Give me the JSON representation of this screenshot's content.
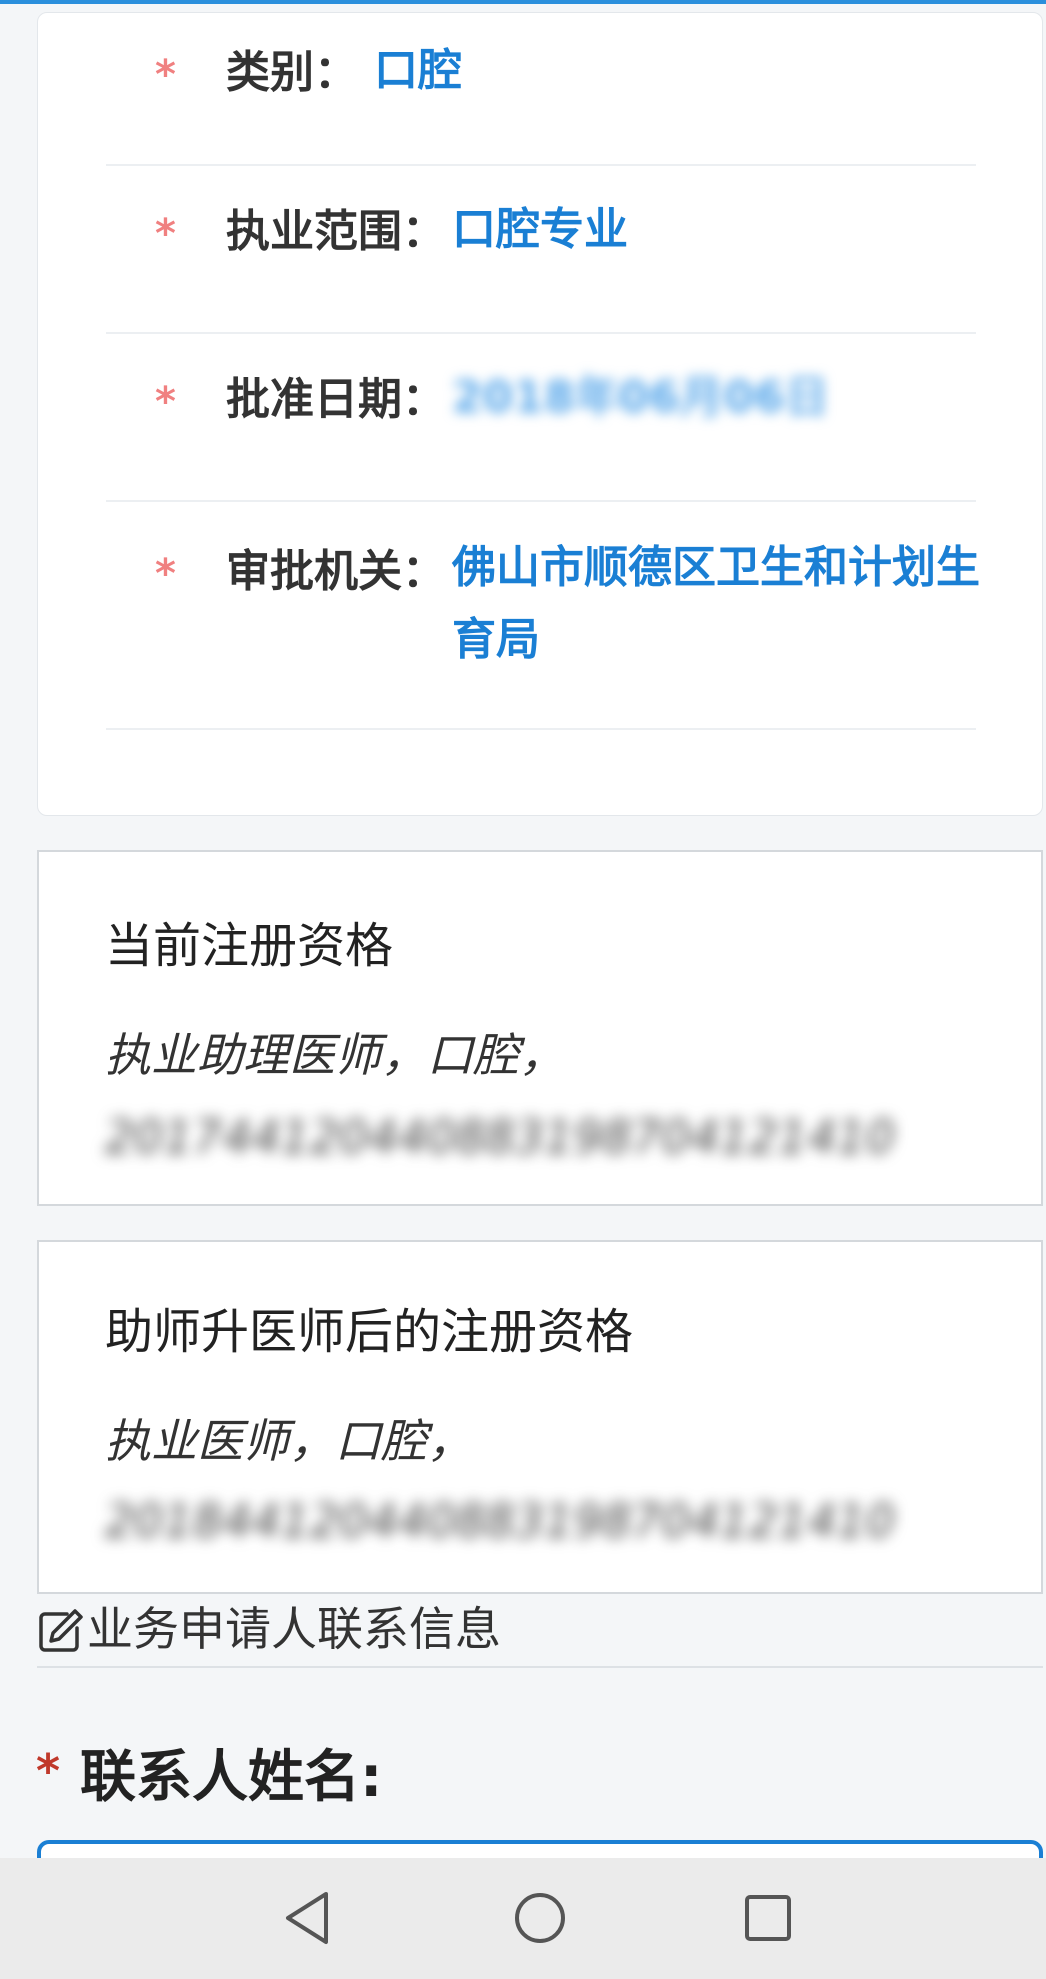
{
  "info_card": {
    "rows": [
      {
        "label": "类别：",
        "value": "口腔"
      },
      {
        "label": "执业范围：",
        "value": "口腔专业"
      },
      {
        "label": "批准日期：",
        "value": "2018年06月06日"
      },
      {
        "label": "审批机关：",
        "value": "佛山市顺德区卫生和计划生育局"
      }
    ],
    "required_mark": "*"
  },
  "current_qualification": {
    "title": "当前注册资格",
    "value": "执业助理医师，口腔，",
    "id": "201744120440883198704121410"
  },
  "upgraded_qualification": {
    "title": "助师升医师后的注册资格",
    "value": "执业医师，口腔，",
    "id": "201844120440883198704121410"
  },
  "contact_section": {
    "icon": "edit-icon",
    "title": "业务申请人联系信息",
    "name_label": "联系人姓名:",
    "name_value": "",
    "required_mark": "*"
  },
  "nav": {
    "back_icon": "back-triangle-icon",
    "home_icon": "home-circle-icon",
    "recents_icon": "recents-square-icon"
  },
  "colors": {
    "accent": "#1a7fd4",
    "required_star": "#f08080",
    "top_bar": "#2a8fdc"
  }
}
